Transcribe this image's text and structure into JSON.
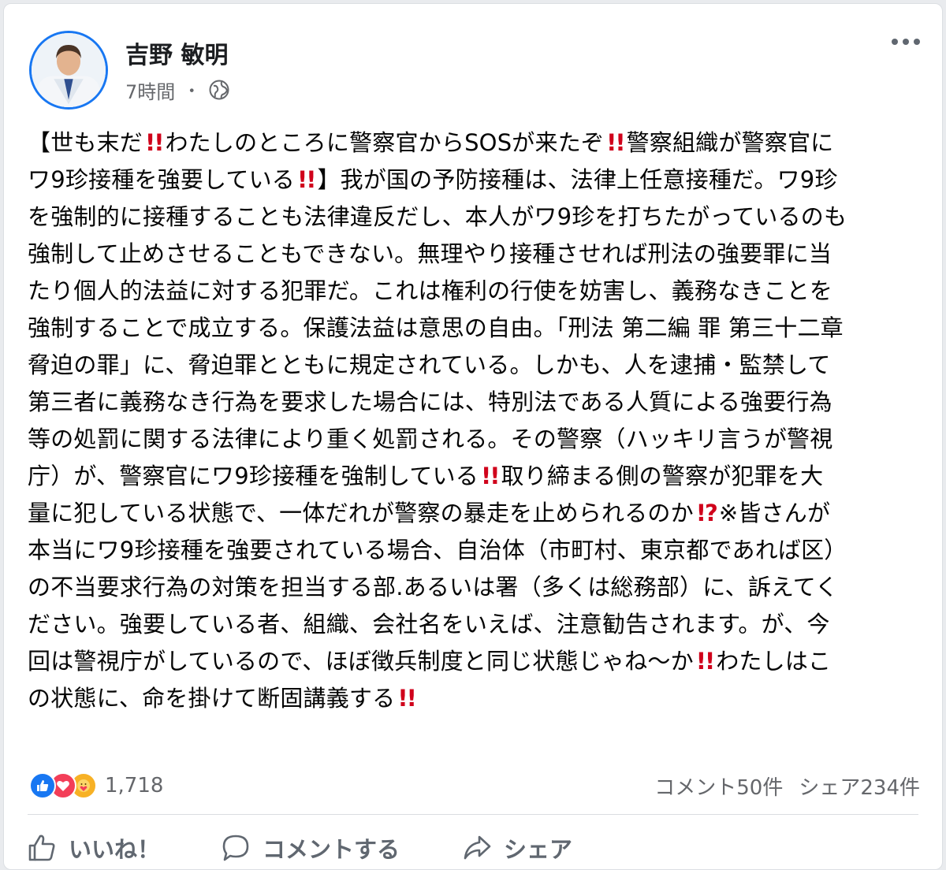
{
  "post": {
    "author": "吉野 敏明",
    "time": "7時間",
    "separator": "・",
    "body_lines": [
      "【世も末だ‼️わたしのところに警察官からSOSが来たぞ‼️警察組織が警察官に",
      "ワ9珍接種を強要している‼️】我が国の予防接種は、法律上任意接種だ。ワ9珍",
      "を強制的に接種することも法律違反だし、本人がワ9珍を打ちたがっているのも",
      "強制して止めさせることもできない。無理やり接種させれば刑法の強要罪に当",
      "たり個人的法益に対する犯罪だ。これは権利の行使を妨害し、義務なきことを",
      "強制することで成立する。保護法益は意思の自由。「刑法 第二編 罪 第三十二章",
      "脅迫の罪」に、脅迫罪とともに規定されている。しかも、人を逮捕・監禁して",
      "第三者に義務なき行為を要求した場合には、特別法である人質による強要行為",
      "等の処罰に関する法律により重く処罰される。その警察（ハッキリ言うが警視",
      "庁）が、警察官にワ9珍接種を強制している‼️取り締まる側の警察が犯罪を大",
      "量に犯している状態で、一体だれが警察の暴走を止められるのか⁉️※皆さんが",
      "本当にワ9珍接種を強要されている場合、自治体（市町村、東京都であれば区）",
      "の不当要求行為の対策を担当する部.あるいは署（多くは総務部）に、訴えてく",
      "ださい。強要している者、組織、会社名をいえば、注意勧告されます。が、今",
      "回は警視庁がしているので、ほぼ徴兵制度と同じ状態じゃね〜か‼️わたしはこ",
      "の状態に、命を掛けて断固講義する‼️"
    ]
  },
  "reactions": {
    "icons": [
      "like-icon",
      "love-icon",
      "care-icon"
    ],
    "count": "1,718",
    "comments": "コメント50件",
    "shares": "シェア234件"
  },
  "actions": {
    "like": "いいね！",
    "comment": "コメントする",
    "share": "シェア"
  },
  "colors": {
    "accent": "#1877f2",
    "love": "#f33e58",
    "care": "#f7b125",
    "emphasis": "#d0021b"
  }
}
